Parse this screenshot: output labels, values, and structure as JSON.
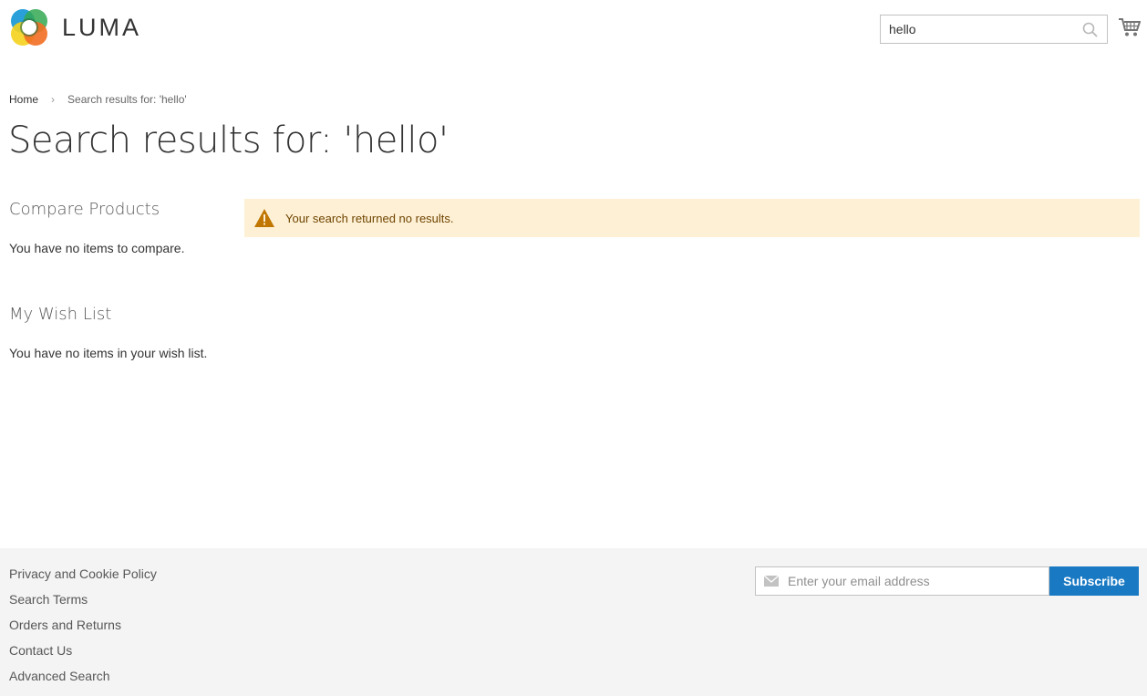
{
  "header": {
    "logo_text": "LUMA",
    "search": {
      "value": "hello",
      "placeholder": ""
    }
  },
  "breadcrumb": {
    "home": "Home",
    "current": "Search results for: 'hello'"
  },
  "page_title": "Search results for: 'hello'",
  "sidebar": {
    "compare": {
      "title": "Compare Products",
      "text": "You have no items to compare."
    },
    "wishlist": {
      "title": "My Wish List",
      "text": "You have no items in your wish list."
    }
  },
  "message": {
    "text": "Your search returned no results."
  },
  "footer": {
    "links": [
      "Privacy and Cookie Policy",
      "Search Terms",
      "Orders and Returns",
      "Contact Us",
      "Advanced Search"
    ],
    "newsletter": {
      "placeholder": "Enter your email address",
      "button": "Subscribe"
    }
  },
  "colors": {
    "accent": "#1979c3",
    "warning_bg": "#fdf0d5",
    "warning_icon": "#c07600",
    "footer_bg": "#f4f4f4"
  },
  "icons": [
    "luma-logo-icon",
    "search-icon",
    "cart-icon",
    "warning-icon",
    "mail-icon"
  ]
}
